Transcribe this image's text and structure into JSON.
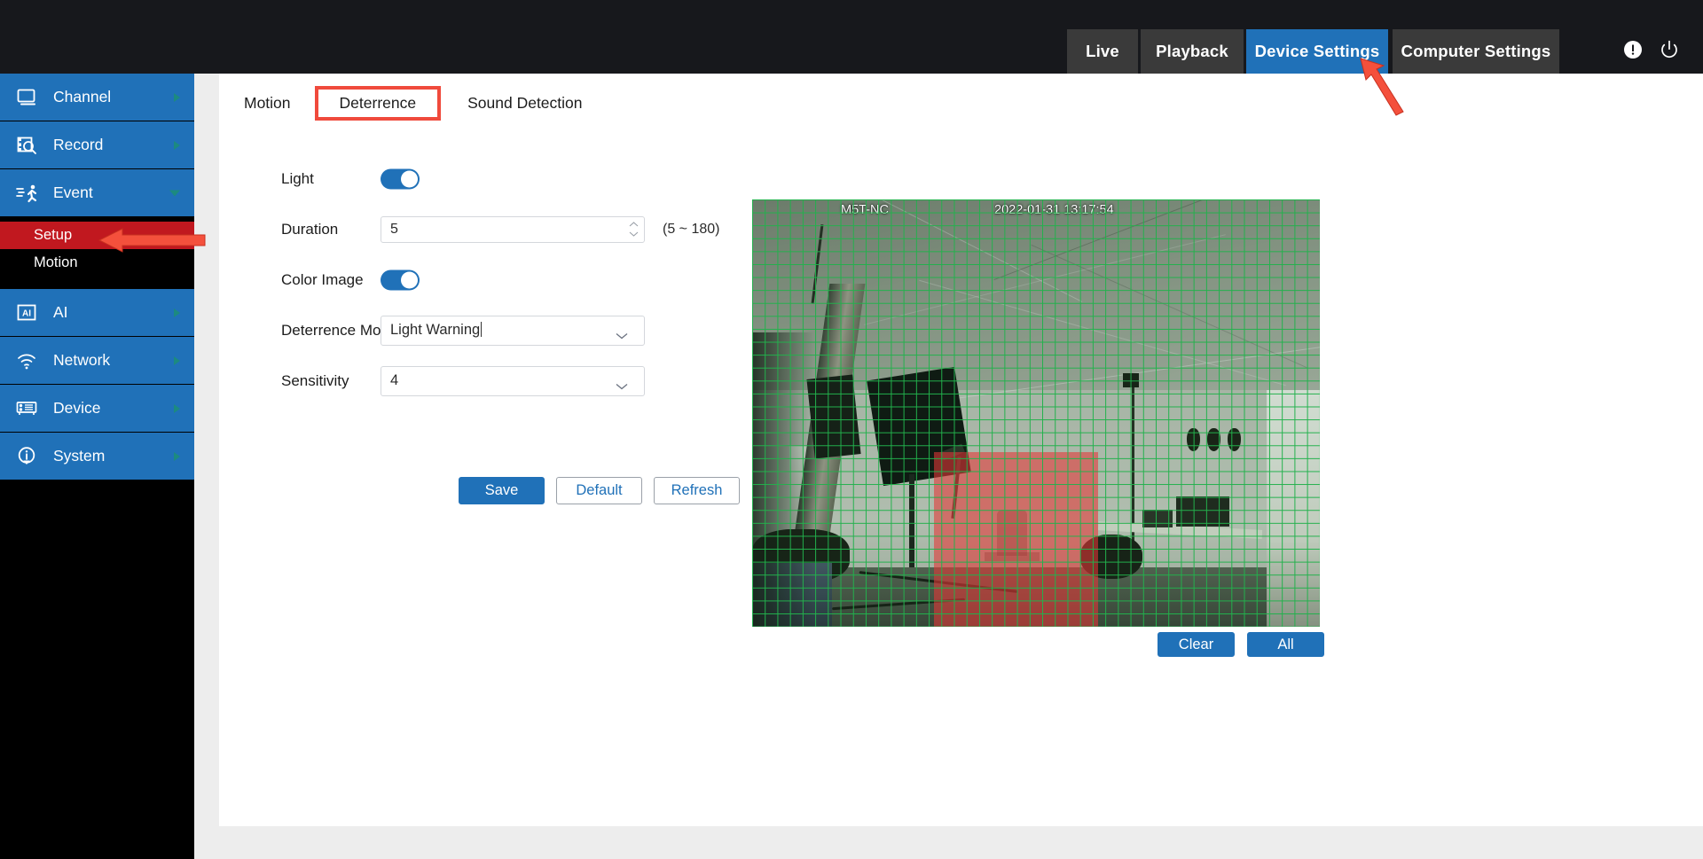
{
  "topnav": {
    "items": [
      {
        "label": "Live",
        "active": false
      },
      {
        "label": "Playback",
        "active": false
      },
      {
        "label": "Device Settings",
        "active": true
      },
      {
        "label": "Computer Settings",
        "active": false
      }
    ],
    "icons": [
      {
        "name": "info-alert-icon",
        "glyph": "!"
      },
      {
        "name": "power-icon",
        "glyph": "power"
      }
    ],
    "accent_active": "#2071b8",
    "accent_inactive": "#3a3a3a",
    "background": "#17181c"
  },
  "sidebar": {
    "background": "#000000",
    "item_background": "#2071b8",
    "active_sub_background": "#c1181f",
    "items": [
      {
        "label": "Channel",
        "icon": "monitor-icon",
        "expanded": false
      },
      {
        "label": "Record",
        "icon": "record-search-icon",
        "expanded": false
      },
      {
        "label": "Event",
        "icon": "motion-runner-icon",
        "expanded": true
      },
      {
        "label": "AI",
        "icon": "ai-icon",
        "expanded": false
      },
      {
        "label": "Network",
        "icon": "wifi-icon",
        "expanded": false
      },
      {
        "label": "Device",
        "icon": "device-rack-icon",
        "expanded": false
      },
      {
        "label": "System",
        "icon": "info-icon",
        "expanded": false
      }
    ],
    "event_subitems": [
      {
        "label": "Setup",
        "active": true
      },
      {
        "label": "Motion",
        "active": false
      }
    ]
  },
  "main": {
    "tabs": [
      {
        "label": "Motion",
        "highlighted": false
      },
      {
        "label": "Deterrence",
        "highlighted": true
      },
      {
        "label": "Sound Detection",
        "highlighted": false
      }
    ],
    "highlight_color": "#f04a3c",
    "form": [
      {
        "label": "Light",
        "type": "toggle",
        "value": "on"
      },
      {
        "label": "Duration",
        "type": "number",
        "value": "5",
        "hint": "(5 ~ 180)"
      },
      {
        "label": "Color Image",
        "type": "toggle",
        "value": "on"
      },
      {
        "label": "Deterrence Mode",
        "type": "select",
        "value": "Light Warning",
        "focused": true
      },
      {
        "label": "Sensitivity",
        "type": "select",
        "value": "4",
        "focused": false
      }
    ],
    "buttons": [
      {
        "label": "Save",
        "style": "primary"
      },
      {
        "label": "Default",
        "style": "ghost"
      },
      {
        "label": "Refresh",
        "style": "ghost"
      }
    ]
  },
  "video": {
    "overlay_name": "M5T-NC",
    "overlay_time": "2022-01-31 13:17:54",
    "grid_color": "#22b14c",
    "selection_color": "#e63737",
    "buttons": [
      {
        "label": "Clear",
        "style": "primary"
      },
      {
        "label": "All",
        "style": "primary"
      }
    ]
  },
  "annotations": [
    {
      "name": "arrow-pointing-setup",
      "color": "#f4503c"
    },
    {
      "name": "arrow-pointing-device-settings",
      "color": "#f4503c"
    }
  ]
}
